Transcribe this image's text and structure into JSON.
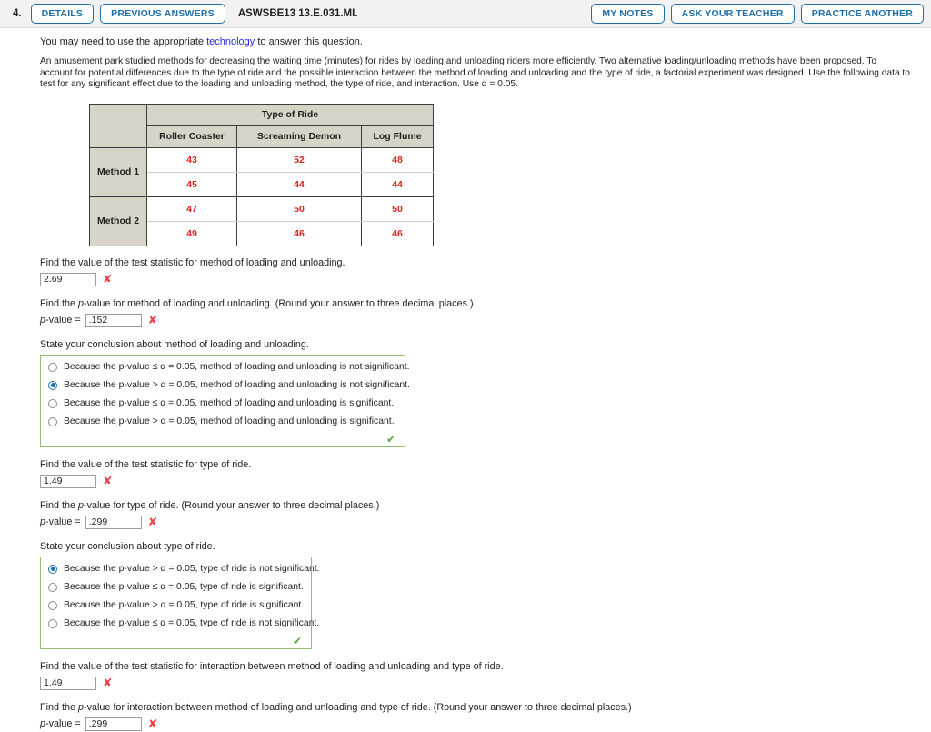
{
  "header": {
    "question_number": "4.",
    "details_label": "DETAILS",
    "previous_answers_label": "PREVIOUS ANSWERS",
    "question_code": "ASWSBE13 13.E.031.MI.",
    "my_notes_label": "MY NOTES",
    "ask_teacher_label": "ASK YOUR TEACHER",
    "practice_another_label": "PRACTICE ANOTHER",
    "accent_color": "#1f6fa8"
  },
  "intro": {
    "before_link": "You may need to use the appropriate ",
    "link_text": "technology",
    "after_link": " to answer this question.",
    "link_color": "#2a2ae0"
  },
  "problem": {
    "text": "An amusement park studied methods for decreasing the waiting time (minutes) for rides by loading and unloading riders more efficiently. Two alternative loading/unloading methods have been proposed. To account for potential differences due to the type of ride and the possible interaction between the method of loading and unloading and the type of ride, a factorial experiment was designed. Use the following data to test for any significant effect due to the loading and unloading method, the type of ride, and interaction. Use α = 0.05."
  },
  "table": {
    "group_header": "Type of Ride",
    "columns": [
      "Roller Coaster",
      "Screaming Demon",
      "Log Flume"
    ],
    "rows": [
      {
        "label": "Method 1",
        "values": [
          [
            "43",
            "52",
            "48"
          ],
          [
            "45",
            "44",
            "44"
          ]
        ]
      },
      {
        "label": "Method 2",
        "values": [
          [
            "47",
            "50",
            "50"
          ],
          [
            "49",
            "46",
            "46"
          ]
        ]
      }
    ],
    "header_bg": "#d7d4c8",
    "value_color": "#e02020"
  },
  "parts": [
    {
      "id": "method",
      "stat_prompt": "Find the value of the test statistic for method of loading and unloading.",
      "stat_value": "2.69",
      "stat_mark": "✘",
      "pvalue_prompt_plain_1": "Find the ",
      "pvalue_prompt_italic": "p",
      "pvalue_prompt_plain_2": "-value for method of loading and unloading. (Round your answer to three decimal places.)",
      "pvalue_label_italic": "p",
      "pvalue_label_rest": "-value =",
      "pvalue_value": ".152",
      "pvalue_mark": "✘",
      "conclusion_prompt": "State your conclusion about method of loading and unloading.",
      "choices": [
        "Because the p-value ≤ α = 0.05, method of loading and unloading is not significant.",
        "Because the p-value > α = 0.05, method of loading and unloading is not significant.",
        "Because the p-value ≤ α = 0.05, method of loading and unloading is significant.",
        "Because the p-value > α = 0.05, method of loading and unloading is significant."
      ],
      "selected_index": 1,
      "correct_mark": "✔"
    },
    {
      "id": "ride",
      "stat_prompt": "Find the value of the test statistic for type of ride.",
      "stat_value": "1.49",
      "stat_mark": "✘",
      "pvalue_prompt_plain_1": "Find the ",
      "pvalue_prompt_italic": "p",
      "pvalue_prompt_plain_2": "-value for type of ride. (Round your answer to three decimal places.)",
      "pvalue_label_italic": "p",
      "pvalue_label_rest": "-value =",
      "pvalue_value": ".299",
      "pvalue_mark": "✘",
      "conclusion_prompt": "State your conclusion about type of ride.",
      "choices": [
        "Because the p-value > α = 0.05, type of ride is not significant.",
        "Because the p-value ≤ α = 0.05, type of ride is significant.",
        "Because the p-value > α = 0.05, type of ride is significant.",
        "Because the p-value ≤ α = 0.05, type of ride is not significant."
      ],
      "selected_index": 0,
      "correct_mark": "✔"
    },
    {
      "id": "interaction",
      "stat_prompt": "Find the value of the test statistic for interaction between method of loading and unloading and type of ride.",
      "stat_value": "1.49",
      "stat_mark": "✘",
      "pvalue_prompt_plain_1": "Find the ",
      "pvalue_prompt_italic": "p",
      "pvalue_prompt_plain_2": "-value for interaction between method of loading and unloading and type of ride. (Round your answer to three decimal places.)",
      "pvalue_label_italic": "p",
      "pvalue_label_rest": "-value =",
      "pvalue_value": ".299",
      "pvalue_mark": "✘"
    }
  ]
}
